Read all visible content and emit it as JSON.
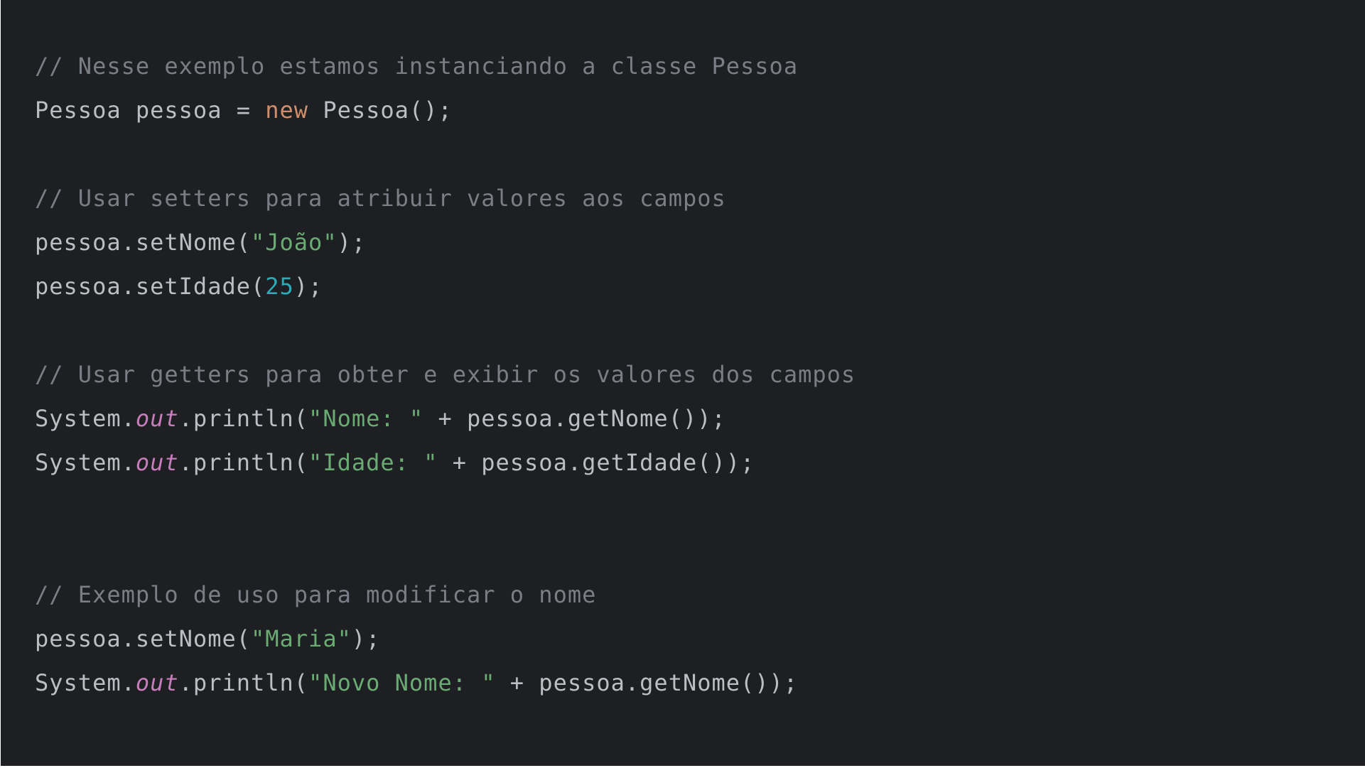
{
  "colors": {
    "background": "#1e1f22",
    "plain": "#bcbec4",
    "comment": "#7a7e85",
    "keyword": "#cf8e6d",
    "string": "#6aab73",
    "number": "#2aacb8",
    "static_field": "#c77dbb"
  },
  "code_lines": [
    [
      {
        "type": "comment",
        "text": "// Nesse exemplo estamos instanciando a classe Pessoa"
      }
    ],
    [
      {
        "type": "plain",
        "text": "Pessoa pessoa = "
      },
      {
        "type": "keyword",
        "text": "new"
      },
      {
        "type": "plain",
        "text": " Pessoa();"
      }
    ],
    [],
    [
      {
        "type": "comment",
        "text": "// Usar setters para atribuir valores aos campos"
      }
    ],
    [
      {
        "type": "plain",
        "text": "pessoa.setNome("
      },
      {
        "type": "string",
        "text": "\"João\""
      },
      {
        "type": "plain",
        "text": ");"
      }
    ],
    [
      {
        "type": "plain",
        "text": "pessoa.setIdade("
      },
      {
        "type": "number",
        "text": "25"
      },
      {
        "type": "plain",
        "text": ");"
      }
    ],
    [],
    [
      {
        "type": "comment",
        "text": "// Usar getters para obter e exibir os valores dos campos"
      }
    ],
    [
      {
        "type": "plain",
        "text": "System."
      },
      {
        "type": "field",
        "text": "out"
      },
      {
        "type": "plain",
        "text": ".println("
      },
      {
        "type": "string",
        "text": "\"Nome: \""
      },
      {
        "type": "plain",
        "text": " + pessoa.getNome());"
      }
    ],
    [
      {
        "type": "plain",
        "text": "System."
      },
      {
        "type": "field",
        "text": "out"
      },
      {
        "type": "plain",
        "text": ".println("
      },
      {
        "type": "string",
        "text": "\"Idade: \""
      },
      {
        "type": "plain",
        "text": " + pessoa.getIdade());"
      }
    ],
    [],
    [],
    [
      {
        "type": "comment",
        "text": "// Exemplo de uso para modificar o nome"
      }
    ],
    [
      {
        "type": "plain",
        "text": "pessoa.setNome("
      },
      {
        "type": "string",
        "text": "\"Maria\""
      },
      {
        "type": "plain",
        "text": ");"
      }
    ],
    [
      {
        "type": "plain",
        "text": "System."
      },
      {
        "type": "field",
        "text": "out"
      },
      {
        "type": "plain",
        "text": ".println("
      },
      {
        "type": "string",
        "text": "\"Novo Nome: \""
      },
      {
        "type": "plain",
        "text": " + pessoa.getNome());"
      }
    ]
  ]
}
